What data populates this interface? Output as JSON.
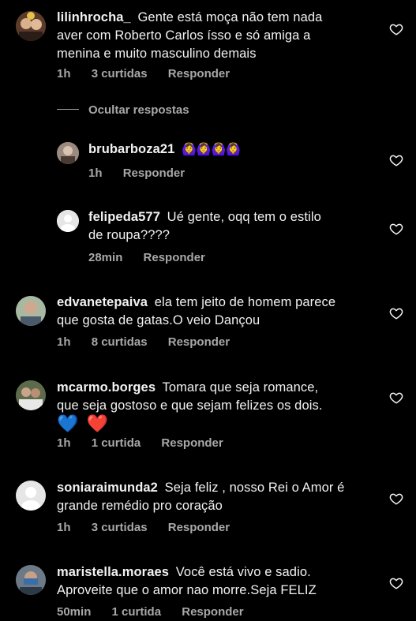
{
  "comments": [
    {
      "username": "lilinhrocha_",
      "text_line1": "Gente está moça não tem nada",
      "text_line2": "aver com Roberto Carlos ísso e só amiga a",
      "text_line3": "menina e muito masculino demais",
      "time": "1h",
      "likes": "3 curtidas",
      "reply": "Responder"
    },
    {
      "username": "edvanetepaiva",
      "text_line1": "ela tem jeito de homem parece",
      "text_line2": "que gosta de gatas.O veio Dançou",
      "time": "1h",
      "likes": "8 curtidas",
      "reply": "Responder"
    },
    {
      "username": "mcarmo.borges",
      "text_line1": "Tomara que seja romance,",
      "text_line2": "que seja gostoso e que sejam felizes os dois.",
      "emoji1": "💙",
      "emoji2": "❤️",
      "time": "1h",
      "likes": "1 curtida",
      "reply": "Responder"
    },
    {
      "username": "soniaraimunda2",
      "text_line1": "Seja feliz , nosso Rei o Amor é",
      "text_line2": "grande remédio pro coração",
      "time": "1h",
      "likes": "3 curtidas",
      "reply": "Responder"
    },
    {
      "username": "maristella.moraes",
      "text_line1": "Você está vivo e sadio.",
      "text_line2": "Aproveite que o amor nao morre.Seja FELIZ",
      "time": "50min",
      "likes": "1 curtida",
      "reply": "Responder"
    }
  ],
  "hide_replies_label": "Ocultar respostas",
  "replies": [
    {
      "username": "brubarboza21",
      "text": "🙆‍♀️🙆‍♀️🙆‍♀️🙆‍♀️",
      "time": "1h",
      "reply": "Responder"
    },
    {
      "username": "felipeda577",
      "text_line1": "Ué gente, oqq tem o estilo",
      "text_line2": "de roupa????",
      "time": "28min",
      "reply": "Responder"
    }
  ],
  "icons": {
    "like": "heart-outline-icon",
    "default_avatar": "default-avatar-icon"
  }
}
